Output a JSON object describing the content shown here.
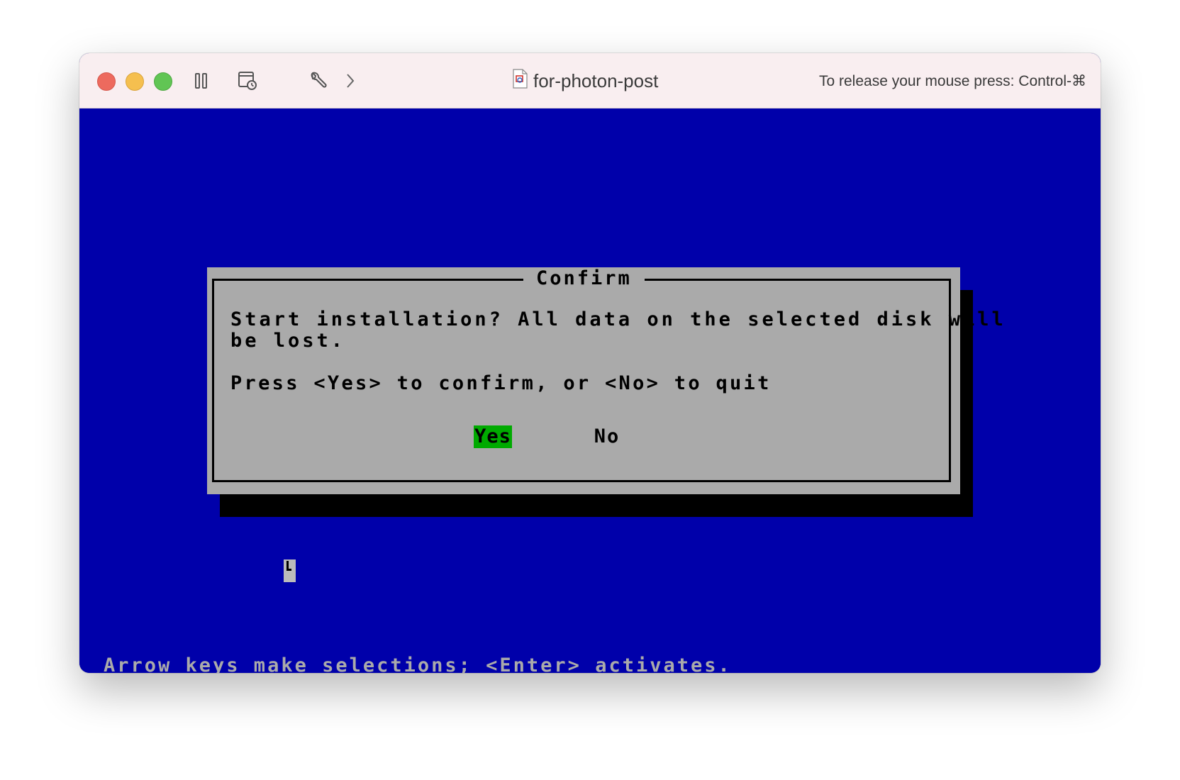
{
  "window": {
    "title": "for-photon-post",
    "release_hint": "To release your mouse press: Control-⌘",
    "toolbar": {
      "pause_icon": "pause-icon",
      "snapshot_icon": "snapshot-icon",
      "settings_icon": "wrench-icon",
      "forward_icon": "chevron-right-icon",
      "document_icon": "vm-document-icon"
    }
  },
  "dialog": {
    "title": "Confirm",
    "message_line1": "Start installation? All data on the selected disk will",
    "message_line2": "be lost.",
    "prompt": "Press <Yes> to confirm, or <No> to quit",
    "yes_label": "Yes",
    "no_label": "No",
    "selected": "Yes"
  },
  "status_line": "Arrow keys make selections; <Enter> activates.",
  "colors": {
    "screen_bg": "#0000aa",
    "dialog_bg": "#aaaaaa",
    "selected_button_bg": "#00aa00",
    "titlebar_bg": "#f9eef0"
  }
}
